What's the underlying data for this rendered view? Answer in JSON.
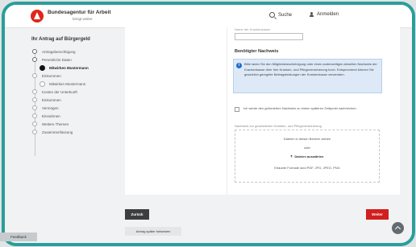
{
  "header": {
    "logo_title": "Bundesagentur für Arbeit",
    "logo_subtitle": "bringt weiter.",
    "search_label": "Suche",
    "login_label": "Anmelden"
  },
  "sidebar": {
    "title": "Ihr Antrag auf Bürgergeld",
    "steps": [
      {
        "label": "Antragsberechtigung",
        "state": "done"
      },
      {
        "label": "Persönliche Daten",
        "state": "done"
      },
      {
        "label": "Mitwirken Mustermann",
        "state": "active"
      },
      {
        "label": "Einkommen",
        "state": "todo"
      },
      {
        "label": "Mitwirken Mustermann",
        "state": "todo"
      },
      {
        "label": "Kosten der Unterkunft",
        "state": "todo"
      },
      {
        "label": "Einkommen",
        "state": "todo"
      },
      {
        "label": "Vermögen",
        "state": "todo"
      },
      {
        "label": "Einnahmen",
        "state": "todo"
      },
      {
        "label": "Weitere Themen",
        "state": "todo"
      },
      {
        "label": "Zusammenfassung",
        "state": "todo"
      }
    ]
  },
  "form": {
    "top_field_label": "Name der Krankenkasse",
    "top_field_value": "",
    "section_heading": "Benötigter Nachweis",
    "info_icon": "i",
    "info_text": "Bitte laden Sie den Mitgliedsbescheinigung oder einen anderweitigen aktuellen Nachweis der Krankenkasse über Ihre Kranken- und Pflegeversicherung hoch. Entsprechend können Sie gesetzlich geregelte Beitragsleistungen der Krankenkasse verwenden.",
    "checkbox_text": "Ich werde den geforderten Nachweis zu einem späteren Zeitpunkt nachreichen.",
    "upload_label": "Nachweis zur gesetzlichen Kranken- und Pflegeversicherung",
    "upload_line1": "Dateien in diesen Bereich ziehen",
    "upload_line2": "oder",
    "upload_select": "Dateien auswählen",
    "upload_formats": "Erlaubte Formate sind PDF, JPG, JPEG, PNG"
  },
  "actions": {
    "back_label": "Zurück",
    "next_label": "Weiter",
    "save_label": "Antrag später fortsetzen",
    "feedback_label": "Feedback"
  }
}
